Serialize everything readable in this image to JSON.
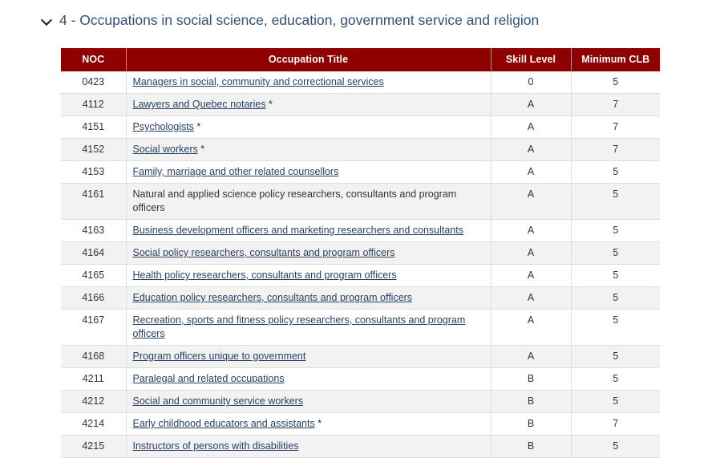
{
  "accordion": {
    "icon": "chevron-down-icon",
    "title": "4 - Occupations in social science, education, government service and religion",
    "expanded": true
  },
  "table": {
    "header_bg": "#8f0000",
    "link_color": "#284162",
    "columns": [
      {
        "key": "noc",
        "label": "NOC"
      },
      {
        "key": "title",
        "label": "Occupation Title"
      },
      {
        "key": "skill",
        "label": "Skill Level"
      },
      {
        "key": "clb",
        "label": "Minimum CLB"
      }
    ],
    "rows": [
      {
        "noc": "0423",
        "title": "Managers in social, community and correctional services",
        "link": true,
        "asterisk": false,
        "skill": "0",
        "clb": "5"
      },
      {
        "noc": "4112",
        "title": "Lawyers and Quebec notaries",
        "link": true,
        "asterisk": true,
        "skill": "A",
        "clb": "7"
      },
      {
        "noc": "4151",
        "title": "Psychologists",
        "link": true,
        "asterisk": true,
        "skill": "A",
        "clb": "7"
      },
      {
        "noc": "4152",
        "title": "Social workers",
        "link": true,
        "asterisk": true,
        "skill": "A",
        "clb": "7"
      },
      {
        "noc": "4153",
        "title": "Family, marriage and other related counsellors",
        "link": true,
        "asterisk": false,
        "skill": "A",
        "clb": "5"
      },
      {
        "noc": "4161",
        "title": "Natural and applied science policy researchers, consultants and program officers",
        "link": false,
        "asterisk": false,
        "skill": "A",
        "clb": "5"
      },
      {
        "noc": "4163",
        "title": "Business development officers and marketing researchers and consultants",
        "link": true,
        "asterisk": false,
        "skill": "A",
        "clb": "5"
      },
      {
        "noc": "4164",
        "title": "Social policy researchers, consultants and program officers",
        "link": true,
        "asterisk": false,
        "skill": "A",
        "clb": "5"
      },
      {
        "noc": "4165",
        "title": "Health policy researchers, consultants and program officers",
        "link": true,
        "asterisk": false,
        "skill": "A",
        "clb": "5"
      },
      {
        "noc": "4166",
        "title": "Education policy researchers, consultants and program officers",
        "link": true,
        "asterisk": false,
        "skill": "A",
        "clb": "5"
      },
      {
        "noc": "4167",
        "title": "Recreation, sports and fitness policy researchers, consultants and program officers",
        "link": true,
        "asterisk": false,
        "skill": "A",
        "clb": "5"
      },
      {
        "noc": "4168",
        "title": "Program officers unique to government",
        "link": true,
        "asterisk": false,
        "skill": "A",
        "clb": "5"
      },
      {
        "noc": "4211",
        "title": "Paralegal and related occupations",
        "link": true,
        "asterisk": false,
        "skill": "B",
        "clb": "5"
      },
      {
        "noc": "4212",
        "title": "Social and community service workers",
        "link": true,
        "asterisk": false,
        "skill": "B",
        "clb": "5"
      },
      {
        "noc": "4214",
        "title": "Early childhood educators and assistants",
        "link": true,
        "asterisk": true,
        "skill": "B",
        "clb": "7"
      },
      {
        "noc": "4215",
        "title": "Instructors of persons with disabilities",
        "link": true,
        "asterisk": false,
        "skill": "B",
        "clb": "5"
      }
    ]
  }
}
